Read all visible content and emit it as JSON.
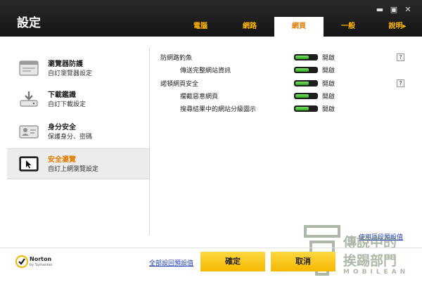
{
  "window": {
    "title": "設定",
    "controls": {
      "minimize": "▬",
      "maximize": "▣",
      "close": "✕"
    }
  },
  "tabs": [
    {
      "label": "電腦",
      "active": false
    },
    {
      "label": "網路",
      "active": false
    },
    {
      "label": "網頁",
      "active": true
    },
    {
      "label": "一般",
      "active": false
    },
    {
      "label": "說明▸",
      "active": false
    }
  ],
  "sidebar": {
    "items": [
      {
        "title": "瀏覽器防護",
        "subtitle": "自訂瀏覽器設定",
        "icon": "browser-window-icon",
        "active": false
      },
      {
        "title": "下載鑑識",
        "subtitle": "自訂下載設定",
        "icon": "download-tray-icon",
        "active": false
      },
      {
        "title": "身分安全",
        "subtitle": "保護身分、密碼",
        "icon": "id-card-icon",
        "active": false
      },
      {
        "title": "安全瀏覽",
        "subtitle": "自訂上網瀏覽設定",
        "icon": "cursor-screen-icon",
        "active": true
      }
    ]
  },
  "settings": {
    "rows": [
      {
        "label": "防網路釣魚",
        "state": "開啟",
        "indent": false,
        "help": "?"
      },
      {
        "label": "傳送完整網站資訊",
        "state": "開啟",
        "indent": true,
        "help": ""
      },
      {
        "label": "諾頓網頁安全",
        "state": "開啟",
        "indent": false,
        "help": "?"
      },
      {
        "label": "攔截惡意網頁",
        "state": "開啟",
        "indent": true,
        "help": ""
      },
      {
        "label": "搜尋結果中的網站分級圖示",
        "state": "開啟",
        "indent": true,
        "help": ""
      }
    ],
    "use_defaults_link": "使用區段預設值"
  },
  "footer": {
    "brand": "Norton",
    "brand_sub": "by Symantec",
    "reset_link": "全部設回預設值",
    "ok_label": "確定",
    "cancel_label": "取消"
  },
  "watermark": {
    "line1": "傳說中的",
    "line2": "挨踢部門",
    "line3": "MOBILEAN"
  },
  "colors": {
    "header_bg": "#1c1c1c",
    "tab_text": "#ffb800",
    "accent_orange": "#e07a00",
    "toggle_on": "#3cc02a",
    "button_yellow": "#f8c800",
    "link_blue": "#1f3fb0"
  }
}
